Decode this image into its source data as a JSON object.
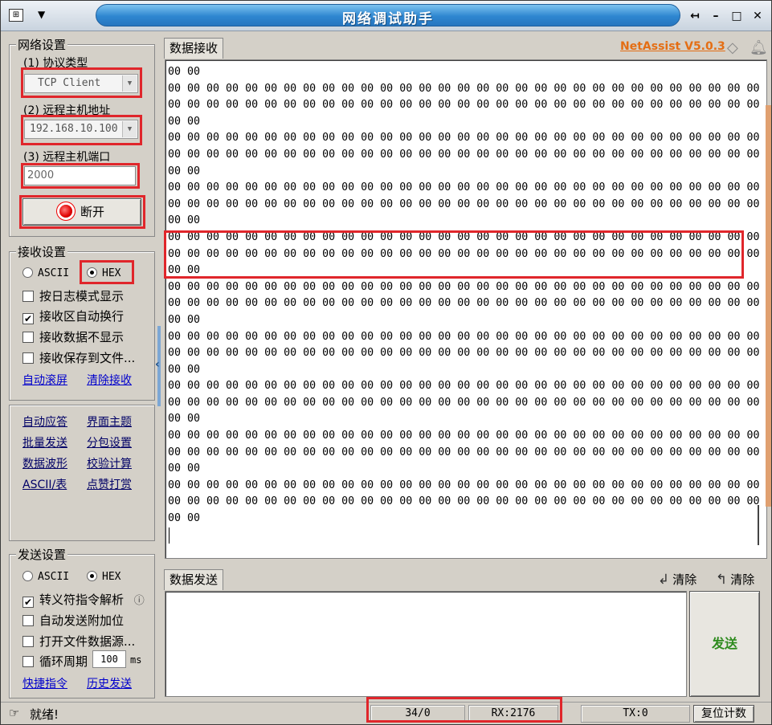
{
  "window": {
    "title": "网络调试助手",
    "sysmenu_icon": "app-network-icon",
    "controls": [
      "↤",
      "–",
      "□",
      "✕"
    ]
  },
  "network": {
    "group_title": "网络设置",
    "protocol_label": "(1) 协议类型",
    "protocol_value": "TCP Client",
    "host_label": "(2) 远程主机地址",
    "host_value": "192.168.10.100",
    "port_label": "(3) 远程主机端口",
    "port_value": "2000",
    "disconnect_label": "断开"
  },
  "receive_settings": {
    "group_title": "接收设置",
    "ascii_label": "ASCII",
    "hex_label": "HEX",
    "selected": "HEX",
    "options": [
      {
        "label": "按日志模式显示",
        "checked": false
      },
      {
        "label": "接收区自动换行",
        "checked": true
      },
      {
        "label": "接收数据不显示",
        "checked": false
      },
      {
        "label": "接收保存到文件...",
        "checked": false
      }
    ],
    "auto_scroll_link": "自动滚屏",
    "clear_receive_link": "清除接收"
  },
  "tools": {
    "links": [
      [
        "自动应答",
        "界面主题"
      ],
      [
        "批量发送",
        "分包设置"
      ],
      [
        "数据波形",
        "校验计算"
      ],
      [
        "ASCII/表",
        "点赞打赏"
      ]
    ]
  },
  "send_settings": {
    "group_title": "发送设置",
    "ascii_label": "ASCII",
    "hex_label": "HEX",
    "selected": "HEX",
    "options": [
      {
        "label": "转义符指令解析",
        "checked": true
      },
      {
        "label": "自动发送附加位",
        "checked": false
      },
      {
        "label": "打开文件数据源...",
        "checked": false
      }
    ],
    "loop_label": "循环周期",
    "loop_value": "100",
    "loop_unit": "ms",
    "shortcut_link": "快捷指令",
    "history_link": "历史发送"
  },
  "receive_area": {
    "tab_label": "数据接收",
    "brand": "NetAssist V5.0.3",
    "lines": [
      "00 00",
      "00 00 00 00 00 00 00 00 00 00 00 00 00 00 00 00 00 00 00 00 00 00 00 00 00 00 00 00 00 00 00 00",
      "00 00 00 00 00 00 00 00 00 00 00 00 00 00 00 00 00 00 00 00 00 00 00 00 00 00 00 00 00 00 00 00",
      "00 00",
      "00 00 00 00 00 00 00 00 00 00 00 00 00 00 00 00 00 00 00 00 00 00 00 00 00 00 00 00 00 00 00 00",
      "00 00 00 00 00 00 00 00 00 00 00 00 00 00 00 00 00 00 00 00 00 00 00 00 00 00 00 00 00 00 00 00",
      "00 00",
      "00 00 00 00 00 00 00 00 00 00 00 00 00 00 00 00 00 00 00 00 00 00 00 00 00 00 00 00 00 00 00 00",
      "00 00 00 00 00 00 00 00 00 00 00 00 00 00 00 00 00 00 00 00 00 00 00 00 00 00 00 00 00 00 00 00",
      "00 00",
      "00 00 00 00 00 00 00 00 00 00 00 00 00 00 00 00 00 00 00 00 00 00 00 00 00 00 00 00 00 00 00 00",
      "00 00 00 00 00 00 00 00 00 00 00 00 00 00 00 00 00 00 00 00 00 00 00 00 00 00 00 00 00 00 00 00",
      "00 00",
      "00 00 00 00 00 00 00 00 00 00 00 00 00 00 00 00 00 00 00 00 00 00 00 00 00 00 00 00 00 00 00 00",
      "00 00 00 00 00 00 00 00 00 00 00 00 00 00 00 00 00 00 00 00 00 00 00 00 00 00 00 00 00 00 00 00",
      "00 00",
      "00 00 00 00 00 00 00 00 00 00 00 00 00 00 00 00 00 00 00 00 00 00 00 00 00 00 00 00 00 00 00 00",
      "00 00 00 00 00 00 00 00 00 00 00 00 00 00 00 00 00 00 00 00 00 00 00 00 00 00 00 00 00 00 00 00",
      "00 00",
      "00 00 00 00 00 00 00 00 00 00 00 00 00 00 00 00 00 00 00 00 00 00 00 00 00 00 00 00 00 00 00 00",
      "00 00 00 00 00 00 00 00 00 00 00 00 00 00 00 00 00 00 00 00 00 00 00 00 00 00 00 00 00 00 00 00",
      "00 00",
      "00 00 00 00 00 00 00 00 00 00 00 00 00 00 00 00 00 00 00 00 00 00 00 00 00 00 00 00 00 00 00 00",
      "00 00 00 00 00 00 00 00 00 00 00 00 00 00 00 00 00 00 00 00 00 00 00 00 00 00 00 00 00 00 00 00",
      "00 00",
      "00 00 00 00 00 00 00 00 00 00 00 00 00 00 00 00 00 00 00 00 00 00 00 00 00 00 00 00 00 00 00 00",
      "00 00 00 00 00 00 00 00 00 00 00 00 00 00 00 00 00 00 00 00 00 00 00 00 00 00 00 00 00 00 00 00",
      "00 00"
    ]
  },
  "send_area": {
    "tab_label": "数据发送",
    "clear1_label": "清除",
    "clear2_label": "清除",
    "send_label": "发送"
  },
  "status_bar": {
    "ready_text": "就绪!",
    "counter": "34/0",
    "rx": "RX:2176",
    "tx": "TX:0",
    "reset_label": "复位计数"
  },
  "highlight_color": "#e0262b",
  "brand_color": "#e46e14"
}
